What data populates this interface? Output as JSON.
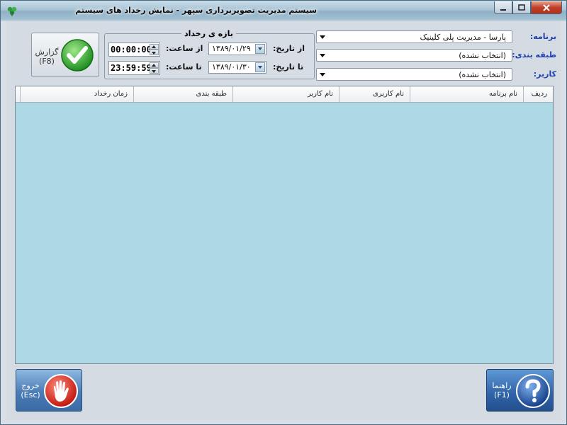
{
  "window": {
    "title": "سیستم مدیریت تصویربرداری سپهر - نمایش رخداد های سیستم"
  },
  "filters": {
    "program_label": "برنامه:",
    "program_value": "پارسا - مدیریت پلی کلینیک",
    "category_label": "طبقه بندی:",
    "category_value": "(انتخاب نشده)",
    "user_label": "کاربر:",
    "user_value": "(انتخاب نشده)"
  },
  "range": {
    "title": "بازه ی رخداد",
    "from_date_label": "از تاریخ:",
    "from_date_value": "۱۳۸۹/۰۱/۲۹",
    "from_time_label": "از ساعت:",
    "from_time_value": "00:00:00",
    "to_date_label": "تا تاریخ:",
    "to_date_value": "۱۳۸۹/۰۱/۳۰",
    "to_time_label": "تا ساعت:",
    "to_time_value": "23:59:59"
  },
  "buttons": {
    "report_label": "گزارش",
    "report_key": "(F8)",
    "exit_label": "خروج",
    "exit_key": "(Esc)",
    "help_label": "راهنما",
    "help_key": "(F1)"
  },
  "table": {
    "columns": [
      "ردیف",
      "نام برنامه",
      "نام کاربری",
      "نام کاربر",
      "طبقه بندی",
      "زمان رخداد"
    ],
    "rows": []
  },
  "colors": {
    "grid_background": "#add8e6",
    "label_blue": "#1f3fae",
    "report_check": "#3bb82f",
    "exit_red": "#d8261c",
    "help_blue": "#1b4f9c"
  }
}
